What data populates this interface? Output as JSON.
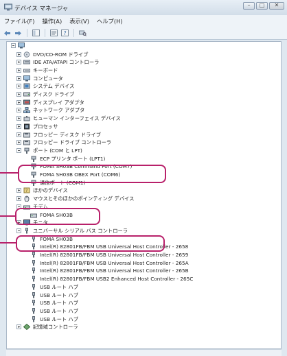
{
  "window": {
    "title": "デバイス マネージャ",
    "controls": [
      "minimize",
      "maximize",
      "close"
    ]
  },
  "menu": [
    "ファイル(F)",
    "操作(A)",
    "表示(V)",
    "ヘルプ(H)"
  ],
  "toolbar": [
    "back-icon",
    "forward-icon",
    "show-hide-tree-icon",
    "properties-icon",
    "help-icon",
    "scan-hardware-icon"
  ],
  "tree": {
    "root": "",
    "categories": [
      "DVD/CD-ROM ドライブ",
      "IDE ATA/ATAPI コントローラ",
      "キーボード",
      "コンピュータ",
      "システム デバイス",
      "ディスク ドライブ",
      "ディスプレイ アダプタ",
      "ネットワーク アダプタ",
      "ヒューマン インターフェイス デバイス",
      "プロセッサ",
      "フロッピー ディスク ドライブ",
      "フロッピー ドライブ コントローラ",
      "ポート (COM と LPT)",
      "ECP プリンタ ポート (LPT1)",
      "FOMA SH03B Command Port (COM7)",
      "FOMA SH03B OBEX Port (COM6)",
      "通信ポート (COM1)",
      "ほかのデバイス",
      "マウスとそのほかのポインティング デバイス",
      "モデム",
      "FOMA SH03B",
      "モニタ",
      "ユニバーサル シリアル バス コントローラ",
      "FOMA SH03B",
      "Intel(R) 82801FB/FBM USB Universal Host Controller - 2658",
      "Intel(R) 82801FB/FBM USB Universal Host Controller - 2659",
      "Intel(R) 82801FB/FBM USB Universal Host Controller - 265A",
      "Intel(R) 82801FB/FBM USB Universal Host Controller - 265B",
      "Intel(R) 82801FB/FBM USB2 Enhanced Host Controller - 265C",
      "USB ルート ハブ",
      "USB ルート ハブ",
      "USB ルート ハブ",
      "USB ルート ハブ",
      "USB ルート ハブ",
      "記憶域コントローラ"
    ]
  },
  "colors": {
    "highlight": "#b8206a",
    "pane_bg": "#ffffff",
    "chrome_bg": "#eef3f8"
  }
}
